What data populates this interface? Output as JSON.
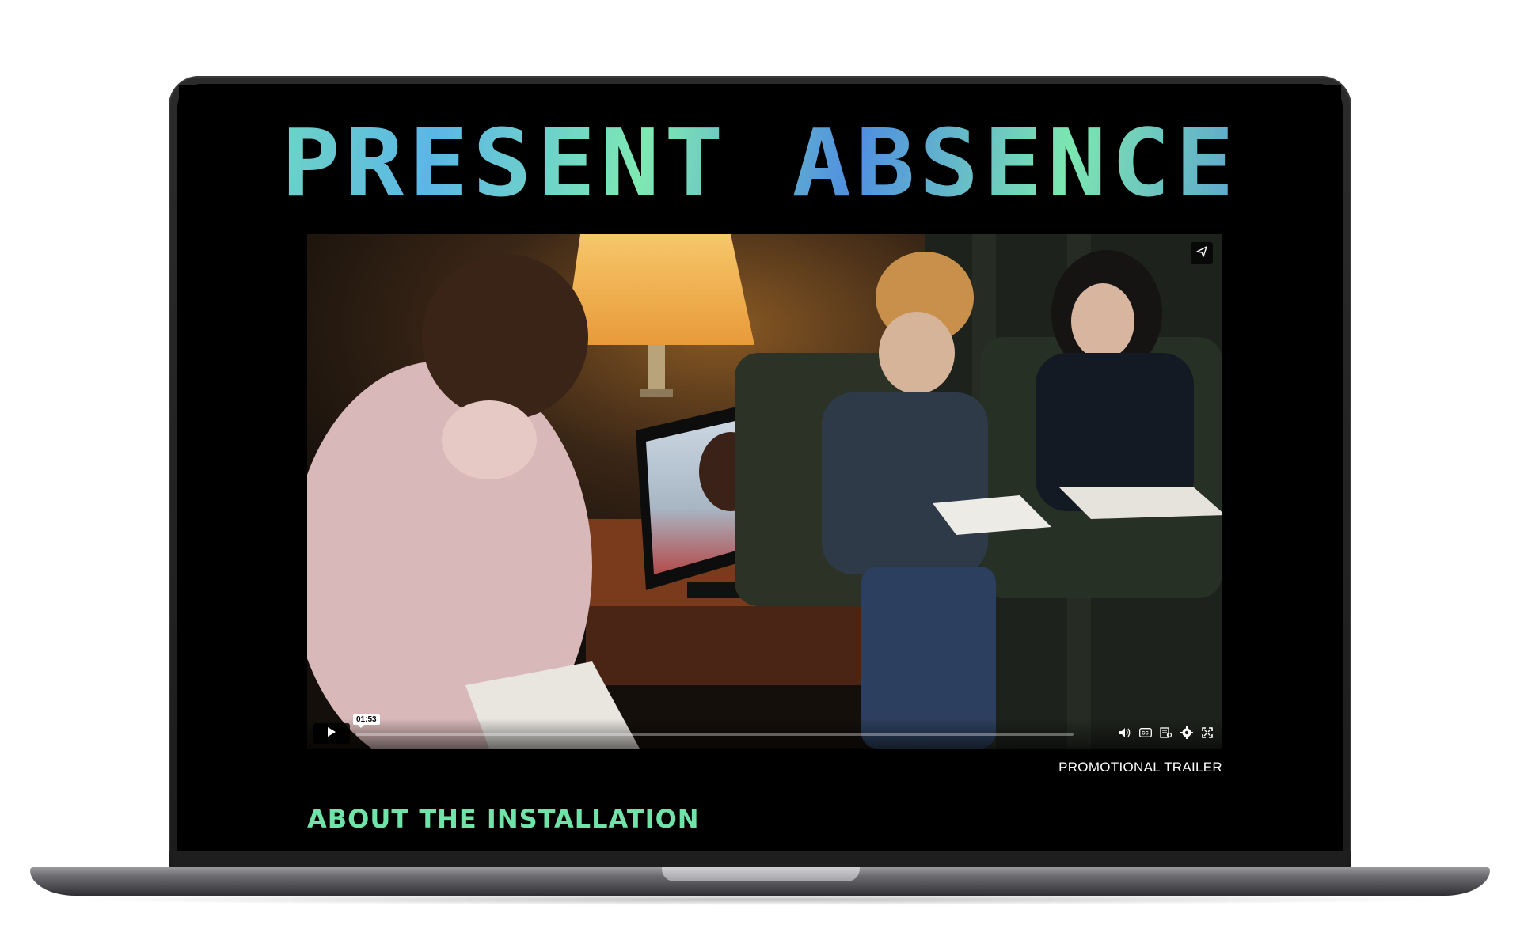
{
  "page": {
    "title": "PRESENT ABSENCE",
    "section_heading": "ABOUT THE INSTALLATION",
    "video_caption": "PROMOTIONAL TRAILER"
  },
  "video_player": {
    "current_time": "01:53",
    "progress": 0.0,
    "controls": {
      "play": "play-icon",
      "share": "share-icon",
      "volume": "volume-icon",
      "captions": "closed-captions-icon",
      "transcript": "transcript-icon",
      "settings": "gear-icon",
      "fullscreen": "fullscreen-icon"
    }
  },
  "colors": {
    "title_gradient_start": "#79e8b0",
    "title_gradient_end": "#4d7ee0",
    "accent_green": "#6fe3a8",
    "screen_background": "#000000"
  }
}
